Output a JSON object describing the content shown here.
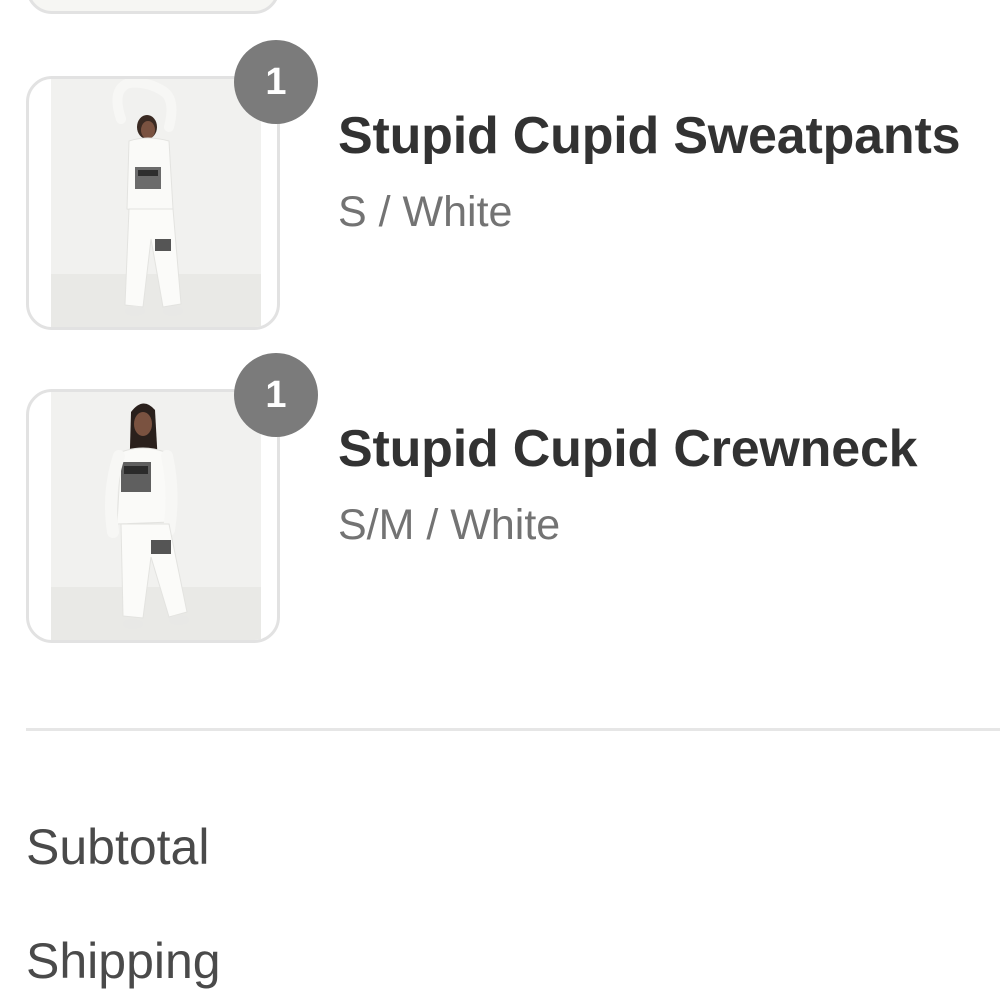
{
  "cart": {
    "items": [
      {
        "name": "Stupid Cupid Sweatpants",
        "variant": "S / White",
        "quantity": "1",
        "image_icon": "product-photo-sweatpants"
      },
      {
        "name": "Stupid Cupid Crewneck",
        "variant": "S/M / White",
        "quantity": "1",
        "image_icon": "product-photo-crewneck"
      }
    ]
  },
  "summary": {
    "subtotal_label": "Subtotal",
    "shipping_label": "Shipping"
  },
  "colors": {
    "badge": "#7b7b7b",
    "title_text": "#323232",
    "variant_text": "#737373",
    "border": "#e2e2e2"
  }
}
